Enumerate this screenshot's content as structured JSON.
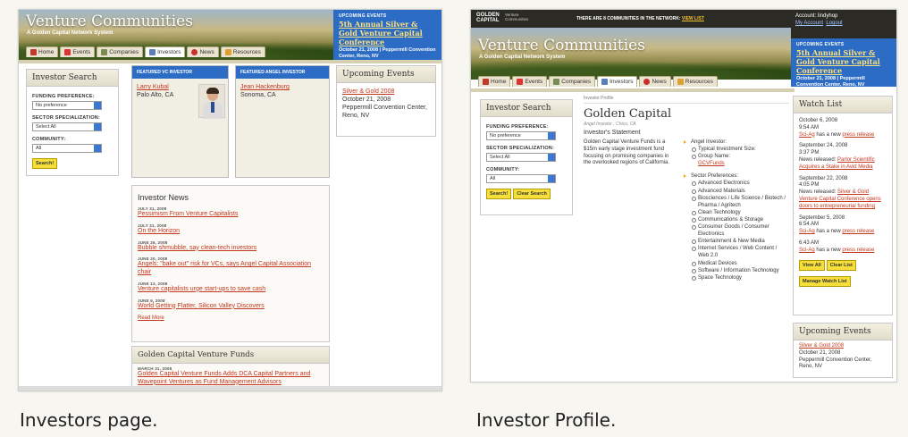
{
  "screen1": {
    "site_title": "Venture Communities",
    "site_subtitle": "A Golden Capital Network System",
    "events": {
      "label": "UPCOMING EVENTS",
      "title": "5th Annual Silver & Gold Venture Capital Conference",
      "date": "October 21, 2008  |  Peppermill Convention Center, Reno, NV"
    },
    "tabs": [
      "Home",
      "Events",
      "Companies",
      "Investors",
      "News",
      "Resources"
    ],
    "active_tab": "Investors",
    "search": {
      "heading": "Investor Search",
      "funding_label": "FUNDING PREFERENCE:",
      "funding_value": "No preference",
      "sector_label": "SECTOR SPECIALIZATION:",
      "sector_value": "Select All",
      "community_label": "COMMUNITY:",
      "community_value": "All",
      "button": "Search!"
    },
    "featured_vc": {
      "heading": "FEATURED VC INVESTOR",
      "name": "Larry Kubal",
      "location": "Palo Alto, CA"
    },
    "featured_angel": {
      "heading": "FEATURED ANGEL INVESTOR",
      "name": "Jean Hackenburg",
      "location": "Sonoma, CA"
    },
    "upcoming": {
      "heading": "Upcoming Events",
      "title": "Silver & Gold 2008",
      "date": "October 21, 2008",
      "venue": "Peppermill Convention Center, Reno, NV"
    },
    "news": {
      "heading": "Investor News",
      "items": [
        {
          "date": "JULY 31, 2008",
          "title": "Pessimism From Venture Capitalists"
        },
        {
          "date": "JULY 31, 2008",
          "title": "On the Horizon"
        },
        {
          "date": "JUNE 26, 2008",
          "title": "Bubble shmubble, say clean-tech investors"
        },
        {
          "date": "JUNE 20, 2008",
          "title": "Angels: \"bake out\" risk for VCs, says Angel Capital Association chair"
        },
        {
          "date": "JUNE 13, 2008",
          "title": "Venture capitalists urge start-ups to save cash"
        },
        {
          "date": "JUNE 6, 2008",
          "title": "World Getting Flatter, Silicon Valley Discovers"
        }
      ],
      "more": "Read More"
    },
    "funds": {
      "heading": "Golden Capital Venture Funds",
      "date": "MARCH 31, 2008",
      "title": "Golden Capital Venture Funds Adds DCA Capital Partners and Wavepoint Ventures as Fund Management Advisors"
    }
  },
  "screen2": {
    "logo_top": "GOLDEN",
    "logo_bottom": "CAPITAL",
    "logo_side": "Venture Communities",
    "network_text": "THERE ARE 8 COMMUNITIES IN THE NETWORK:",
    "view_list": "VIEW LIST",
    "account": {
      "label": "Account: lindyhop",
      "my_account": "My Account",
      "logout": "Logout"
    },
    "site_title": "Venture Communities",
    "site_subtitle": "A Golden Capital Network System",
    "events": {
      "label": "UPCOMING EVENTS",
      "title": "5th Annual Silver & Gold Venture Capital Conference",
      "date": "October 21, 2008  |  Peppermill Convention Center, Reno, NV"
    },
    "tabs": [
      "Home",
      "Events",
      "Companies",
      "Investors",
      "News",
      "Resources"
    ],
    "active_tab": "Investors",
    "search": {
      "heading": "Investor Search",
      "funding_label": "FUNDING PREFERENCE:",
      "funding_value": "No preference",
      "sector_label": "SECTOR SPECIALIZATION:",
      "sector_value": "Select All",
      "community_label": "COMMUNITY:",
      "community_value": "All",
      "search_button": "Search!",
      "clear_button": "Clear Search"
    },
    "profile": {
      "crumb": "Investor Profile",
      "name": "Golden Capital",
      "meta": "Angel Investor , Chico, CA",
      "statement_heading": "Investor's Statement",
      "statement": "Golden Capital Venture Funds is a $15m early stage investment fund focusing on promising companies in the overlooked regions of California.",
      "angel_label": "Angel Investor:",
      "typical_size": "Typical Investment Size:",
      "group_name": "Group Name:",
      "group_link": "GCVFunds",
      "sector_label": "Sector Preferences:",
      "sectors": [
        "Advanced Electronics",
        "Advanced Materials",
        "Biosciences / Life Science / Biotech / Pharma / Agritech",
        "Clean Technology",
        "Communications & Storage",
        "Consumer Goods / Consumer Electronics",
        "Entertainment & New Media",
        "Internet Services / Web Content / Web 2.0",
        "Medical Devices",
        "Software / Information Technology",
        "Space Technology"
      ]
    },
    "watch": {
      "heading": "Watch List",
      "entries": [
        {
          "when": "October 6, 2008",
          "time": "9:54 AM",
          "link": "Sci-Ag",
          "text": "has a new",
          "tail": "press release"
        },
        {
          "when": "September 24, 2008",
          "time": "3:37 PM",
          "text": "News released:",
          "tail": "Parlor Scientific Acquires a Stake in Avid Media"
        },
        {
          "when": "September 22, 2008",
          "time": "4:05 PM",
          "text": "News released:",
          "tail": "Silver & Gold Venture Capital Conference opens doors to entrepreneurial funding"
        },
        {
          "when": "September 5, 2008",
          "time": "6:54 AM",
          "link": "Sci-Ag",
          "text": "has a new",
          "tail": "press release"
        },
        {
          "when": "",
          "time": "6:43 AM",
          "link": "Sci-Ag",
          "text": "has a new",
          "tail": "press release"
        }
      ],
      "view_all": "View All",
      "clear_list": "Clear List",
      "manage": "Manage Watch List"
    },
    "upcoming": {
      "heading": "Upcoming Events",
      "title": "Silver & Gold 2008",
      "date": "October 21, 2008",
      "venue": "Peppermill Convention Center, Reno, NV"
    }
  },
  "captions": {
    "left": "Investors page.",
    "right": "Investor Profile."
  },
  "colors": {
    "accent_blue": "#2c6cc4",
    "link_red": "#c2371d",
    "button_yellow": "#f6df3a"
  }
}
